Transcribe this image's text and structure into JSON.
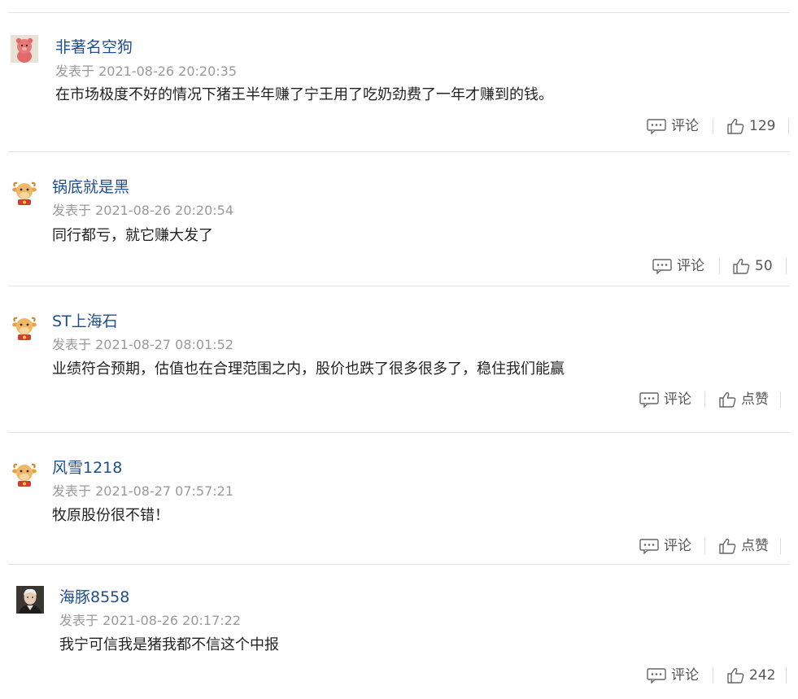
{
  "comments": [
    {
      "user": "非著名空狗",
      "time_prefix": "发表于",
      "time": "2021-08-26 20:20:35",
      "content": "在市场极度不好的情况下猪王半年赚了宁王用了吃奶劲费了一年才赚到的钱。",
      "comment_label": "评论",
      "like_label": "129",
      "avatar": "pink-bear"
    },
    {
      "user": "锅底就是黑",
      "time_prefix": "发表于",
      "time": "2021-08-26 20:20:54",
      "content": "同行都亏，就它赚大发了",
      "comment_label": "评论",
      "like_label": "50",
      "avatar": "cartoon-ox"
    },
    {
      "user": "ST上海石",
      "time_prefix": "发表于",
      "time": "2021-08-27 08:01:52",
      "content": "业绩符合预期，估值也在合理范围之内，股价也跌了很多很多了，稳住我们能赢",
      "comment_label": "评论",
      "like_label": "点赞",
      "avatar": "cartoon-ox"
    },
    {
      "user": "风雪1218",
      "time_prefix": "发表于",
      "time": "2021-08-27 07:57:21",
      "content": "牧原股份很不错！",
      "comment_label": "评论",
      "like_label": "点赞",
      "avatar": "cartoon-ox"
    },
    {
      "user": "海豚8558",
      "time_prefix": "发表于",
      "time": "2021-08-26 20:17:22",
      "content": "我宁可信我是猪我都不信这个中报",
      "comment_label": "评论",
      "like_label": "242",
      "avatar": "man-photo"
    }
  ]
}
